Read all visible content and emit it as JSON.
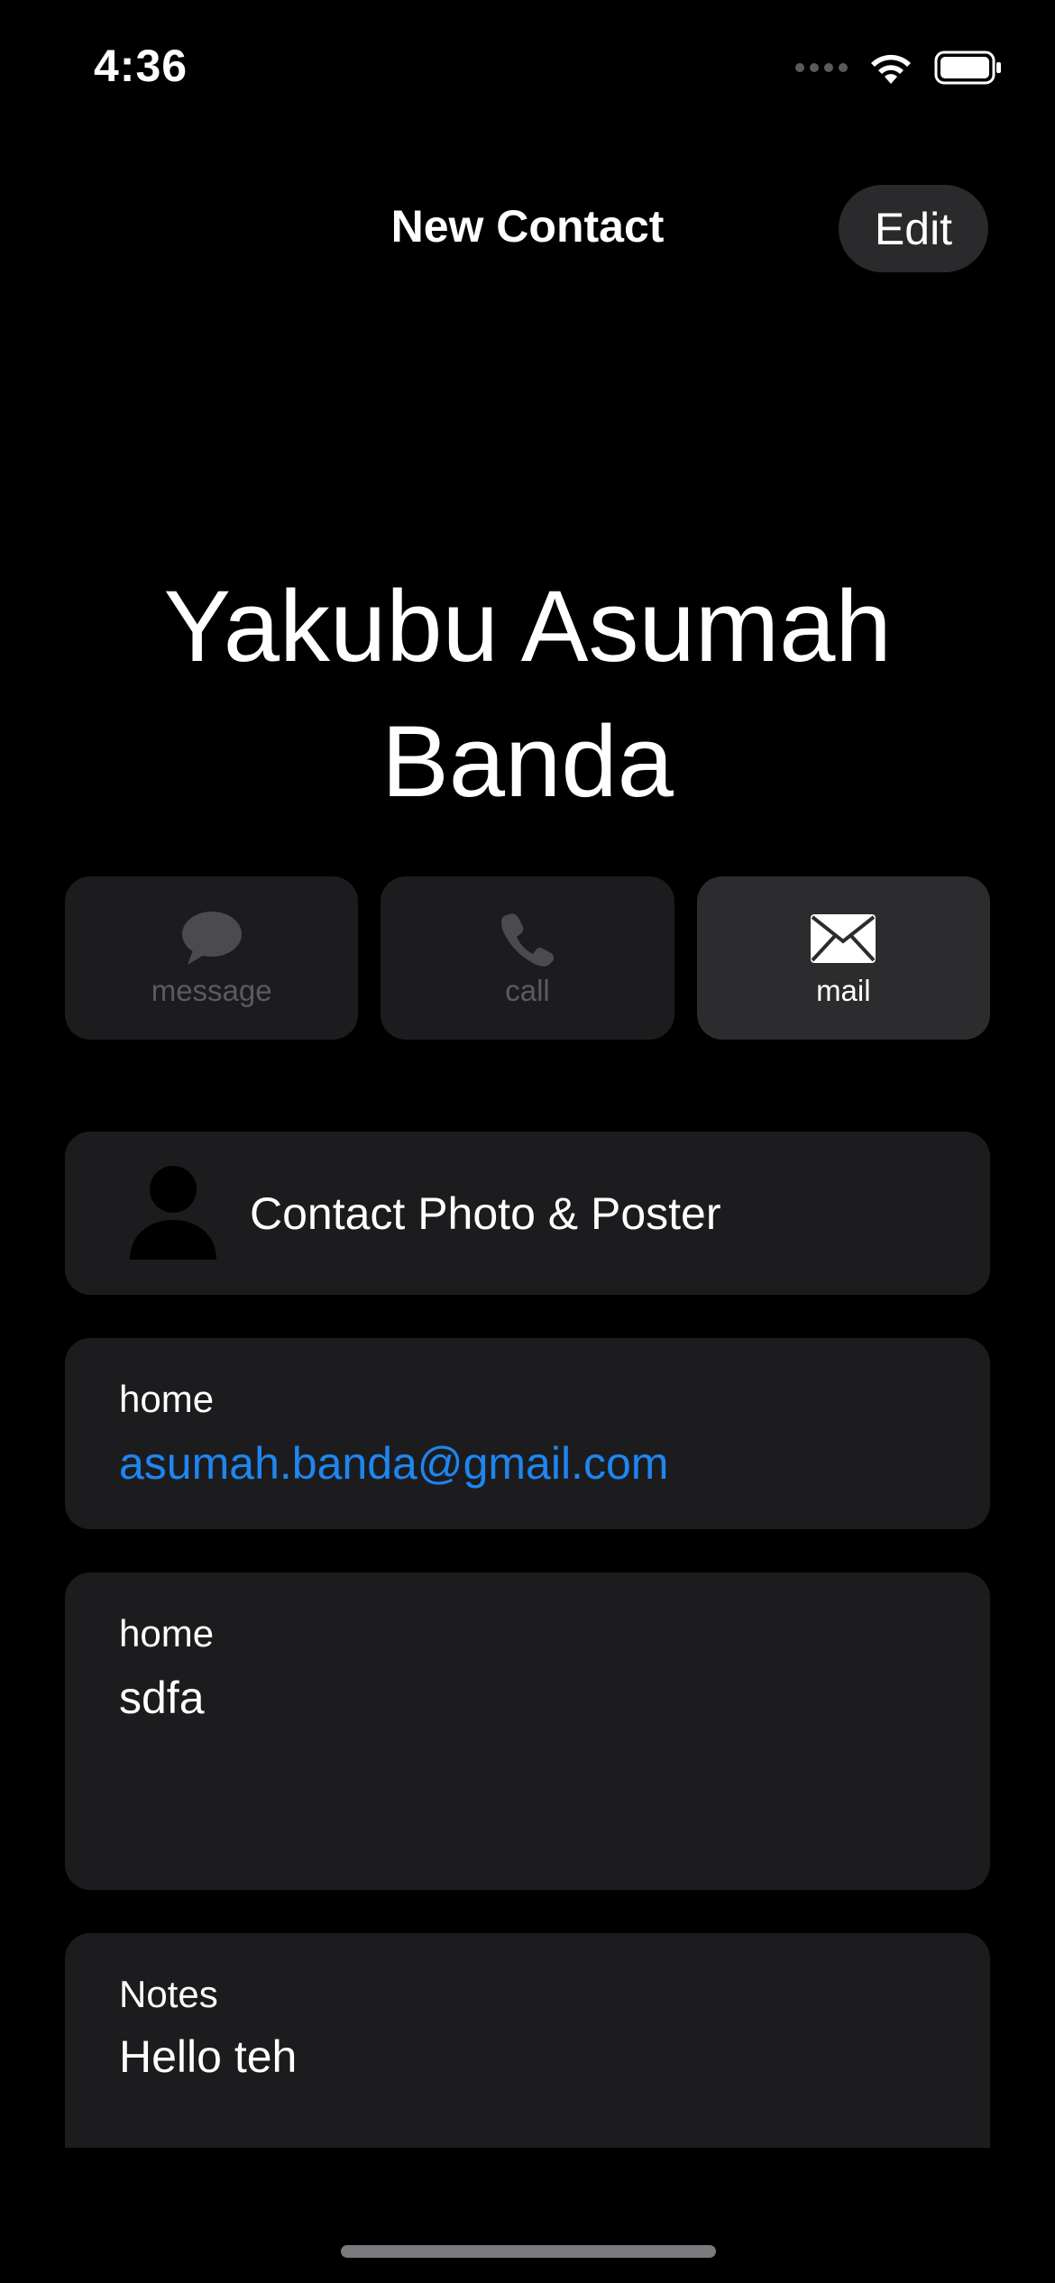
{
  "status_bar": {
    "time": "4:36"
  },
  "nav": {
    "title": "New Contact",
    "edit_label": "Edit"
  },
  "contact": {
    "name_line1": "Yakubu Asumah",
    "name_line2": "Banda"
  },
  "actions": [
    {
      "label": "message",
      "icon": "message-bubble-icon",
      "enabled": false
    },
    {
      "label": "call",
      "icon": "phone-icon",
      "enabled": false
    },
    {
      "label": "mail",
      "icon": "envelope-icon",
      "enabled": true
    }
  ],
  "photo_card": {
    "label": "Contact Photo & Poster",
    "icon": "person-silhouette-icon"
  },
  "email": {
    "label": "home",
    "value": "asumah.banda@gmail.com"
  },
  "address": {
    "label": "home",
    "value": "sdfa"
  },
  "notes": {
    "label": "Notes",
    "value": "Hello teh"
  },
  "colors": {
    "background": "#000000",
    "card": "#1c1c1e",
    "link": "#1e86f0",
    "disabled_text": "#5b5b5f"
  }
}
